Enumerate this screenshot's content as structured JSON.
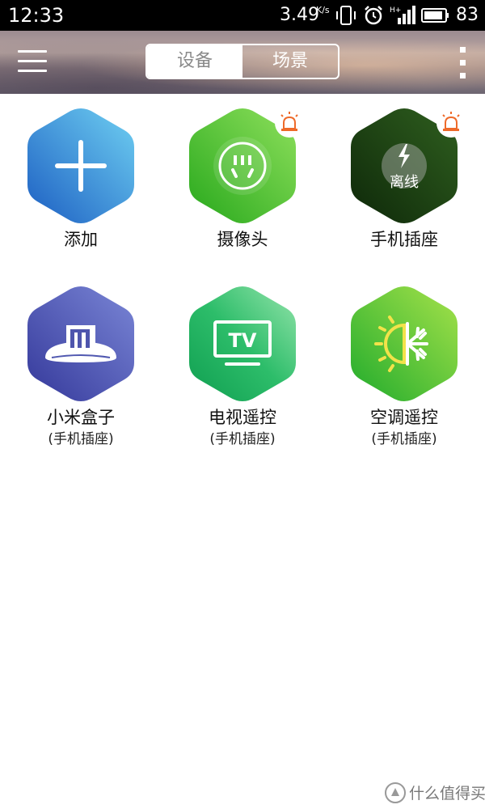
{
  "status_bar": {
    "time": "12:33",
    "network_speed": "3.49",
    "speed_unit": "K/s",
    "battery_percent": "83",
    "icons": [
      "vibrate-icon",
      "alarm-clock-icon",
      "signal-hplus-icon",
      "battery-icon"
    ]
  },
  "header": {
    "menu_icon": "hamburger-menu-icon",
    "tabs": [
      {
        "label": "设备",
        "active": true
      },
      {
        "label": "场景",
        "active": false
      }
    ],
    "more_icon": "more-vertical-icon"
  },
  "devices": [
    {
      "name": "添加",
      "subtitle": "",
      "icon": "plus-icon",
      "color_from": "#6cc8ef",
      "color_to": "#1f63c6"
    },
    {
      "name": "摄像头",
      "subtitle": "",
      "icon": "socket-icon",
      "color_from": "#7ed957",
      "color_to": "#2fb021",
      "badge": "siren-icon"
    },
    {
      "name": "手机插座",
      "subtitle": "",
      "icon": "lightning-icon",
      "status": "离线",
      "color_from": "#2e5a1e",
      "color_to": "#0f2a0a",
      "badge": "siren-icon"
    },
    {
      "name": "小米盒子",
      "subtitle": "(手机插座)",
      "icon": "mi-box-icon",
      "color_from": "#6f78c9",
      "color_to": "#3b3f9e"
    },
    {
      "name": "电视遥控",
      "subtitle": "(手机插座)",
      "icon": "tv-icon",
      "tv_label": "TV",
      "color_from": "#8de0a4",
      "color_to": "#16a85a"
    },
    {
      "name": "空调遥控",
      "subtitle": "(手机插座)",
      "icon": "sun-snowflake-icon",
      "color_from": "#9ee04a",
      "color_to": "#27b12f"
    }
  ],
  "watermark": {
    "text": "什么值得买",
    "icon": "smzdm-logo-icon"
  }
}
